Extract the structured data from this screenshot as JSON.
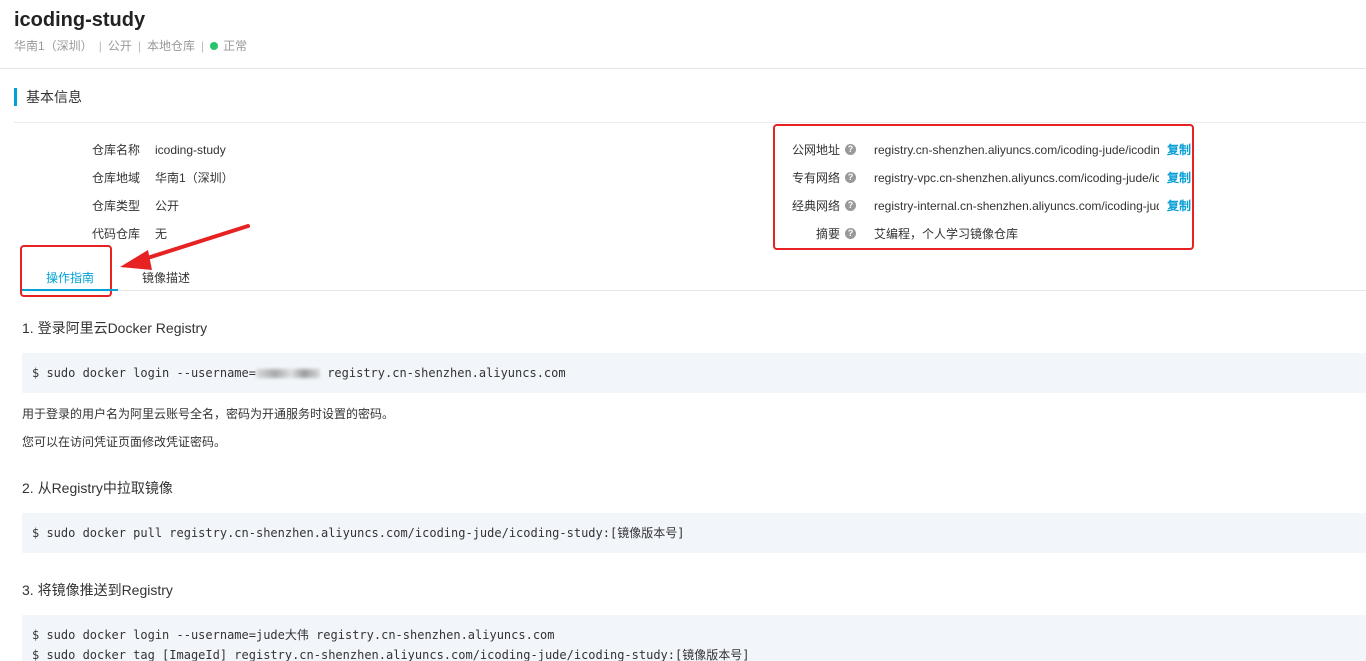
{
  "repo": {
    "name": "icoding-study",
    "region": "华南1（深圳）",
    "visibility": "公开",
    "source": "本地仓库",
    "status": "正常",
    "status_color": "#27c46a"
  },
  "section": {
    "title": "基本信息"
  },
  "info_left": [
    {
      "label": "仓库名称",
      "value": "icoding-study"
    },
    {
      "label": "仓库地域",
      "value": "华南1（深圳）"
    },
    {
      "label": "仓库类型",
      "value": "公开"
    },
    {
      "label": "代码仓库",
      "value": "无"
    }
  ],
  "info_right": [
    {
      "label": "公网地址",
      "value": "registry.cn-shenzhen.aliyuncs.com/icoding-jude/icoding-study",
      "copy": "复制"
    },
    {
      "label": "专有网络",
      "value": "registry-vpc.cn-shenzhen.aliyuncs.com/icoding-jude/icoding-study",
      "copy": "复制"
    },
    {
      "label": "经典网络",
      "value": "registry-internal.cn-shenzhen.aliyuncs.com/icoding-jude/icoding-study",
      "copy": "复制"
    },
    {
      "label": "摘要",
      "value": "艾编程，个人学习镜像仓库"
    }
  ],
  "help_icon_glyph": "?",
  "tabs": [
    {
      "label": "操作指南",
      "active": true
    },
    {
      "label": "镜像描述",
      "active": false
    }
  ],
  "guide": {
    "step1": {
      "title": "1. 登录阿里云Docker Registry",
      "code_prefix": "$ sudo docker login --username=",
      "code_suffix": " registry.cn-shenzhen.aliyuncs.com",
      "note1": "用于登录的用户名为阿里云账号全名，密码为开通服务时设置的密码。",
      "note2": "您可以在访问凭证页面修改凭证密码。"
    },
    "step2": {
      "title": "2. 从Registry中拉取镜像",
      "code": "$ sudo docker pull registry.cn-shenzhen.aliyuncs.com/icoding-jude/icoding-study:[镜像版本号]"
    },
    "step3": {
      "title": "3. 将镜像推送到Registry",
      "code_lines": [
        "$ sudo docker login --username=jude大伟 registry.cn-shenzhen.aliyuncs.com",
        "$ sudo docker tag [ImageId] registry.cn-shenzhen.aliyuncs.com/icoding-jude/icoding-study:[镜像版本号]"
      ]
    }
  },
  "colors": {
    "accent": "#00a1d6",
    "highlight_box": "#e62222",
    "code_bg": "#f2f6fb"
  }
}
